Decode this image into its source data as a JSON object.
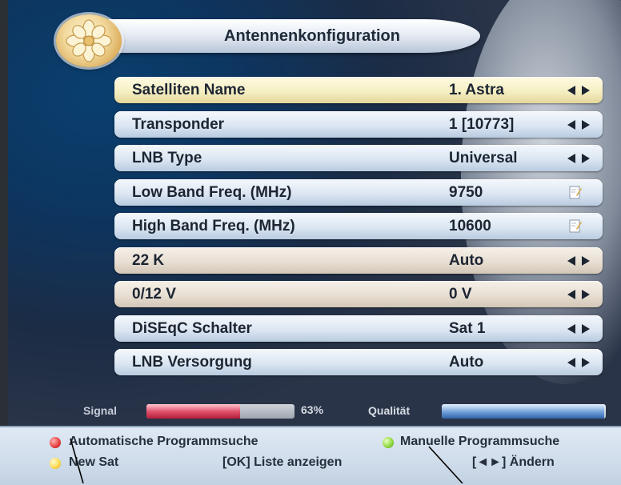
{
  "title": "Antennenkonfiguration",
  "menu": {
    "rows": [
      {
        "label": "Satelliten Name",
        "value": "1. Astra",
        "control": "arrows"
      },
      {
        "label": "Transponder",
        "value": "1 [10773]",
        "control": "arrows"
      },
      {
        "label": "LNB Type",
        "value": "Universal",
        "control": "arrows"
      },
      {
        "label": "Low Band Freq. (MHz)",
        "value": "9750",
        "control": "edit"
      },
      {
        "label": "High Band Freq. (MHz)",
        "value": "10600",
        "control": "edit"
      },
      {
        "label": "22 K",
        "value": "Auto",
        "control": "arrows"
      },
      {
        "label": "0/12 V",
        "value": "0 V",
        "control": "arrows"
      },
      {
        "label": "DiSEqC Schalter",
        "value": "Sat 1",
        "control": "arrows"
      },
      {
        "label": "LNB Versorgung",
        "value": "Auto",
        "control": "arrows"
      }
    ]
  },
  "signal": {
    "label": "Signal",
    "percent_text": "63%",
    "level": 0.63
  },
  "quality": {
    "label": "Qualität",
    "level": 0.99
  },
  "footer": {
    "red_label": "Automatische Programmsuche",
    "green_label": "Manuelle Programmsuche",
    "yellow_label": "New Sat",
    "ok_label": "[OK] Liste anzeigen",
    "change_label": "[◄►] Ändern"
  },
  "colors": {
    "signal_fill": "#d63a55",
    "quality_fill": "#4f86c8",
    "selected_row": "#f6efc4",
    "normal_row": "#dbe6f2"
  }
}
